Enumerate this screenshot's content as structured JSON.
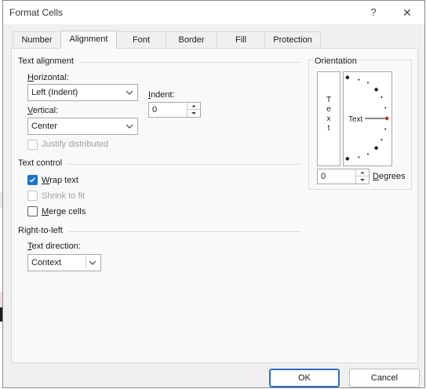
{
  "dialog": {
    "title": "Format Cells",
    "help_glyph": "?",
    "close_glyph": "✕"
  },
  "tabs": [
    {
      "label": "Number",
      "active": false
    },
    {
      "label": "Alignment",
      "active": true
    },
    {
      "label": "Font",
      "active": false
    },
    {
      "label": "Border",
      "active": false
    },
    {
      "label": "Fill",
      "active": false
    },
    {
      "label": "Protection",
      "active": false
    }
  ],
  "text_alignment": {
    "section_label": "Text alignment",
    "horizontal_label_first": "H",
    "horizontal_label_rest": "orizontal:",
    "horizontal_value": "Left (Indent)",
    "vertical_label_first": "V",
    "vertical_label_rest": "ertical:",
    "vertical_value": "Center",
    "indent_label_first": "I",
    "indent_label_rest": "ndent:",
    "indent_value": "0",
    "justify_distributed_label": "Justify distributed"
  },
  "text_control": {
    "section_label": "Text control",
    "wrap_text_first": "W",
    "wrap_text_rest": "rap text",
    "wrap_text_checked": true,
    "shrink_to_fit_label": "Shrink to fit",
    "merge_cells_first": "M",
    "merge_cells_rest": "erge cells",
    "merge_cells_checked": false
  },
  "right_to_left": {
    "section_label": "Right-to-left",
    "text_direction_first": "T",
    "text_direction_rest": "ext direction:",
    "text_direction_value": "Context"
  },
  "orientation": {
    "section_label": "Orientation",
    "vertical_text": [
      "T",
      "e",
      "x",
      "t"
    ],
    "dial_text": "Text",
    "degrees_value": "0",
    "degrees_first": "D",
    "degrees_rest": "egrees"
  },
  "buttons": {
    "ok": "OK",
    "cancel": "Cancel"
  },
  "colors": {
    "accent": "#1a73c8",
    "dial_marker": "#b22222"
  }
}
